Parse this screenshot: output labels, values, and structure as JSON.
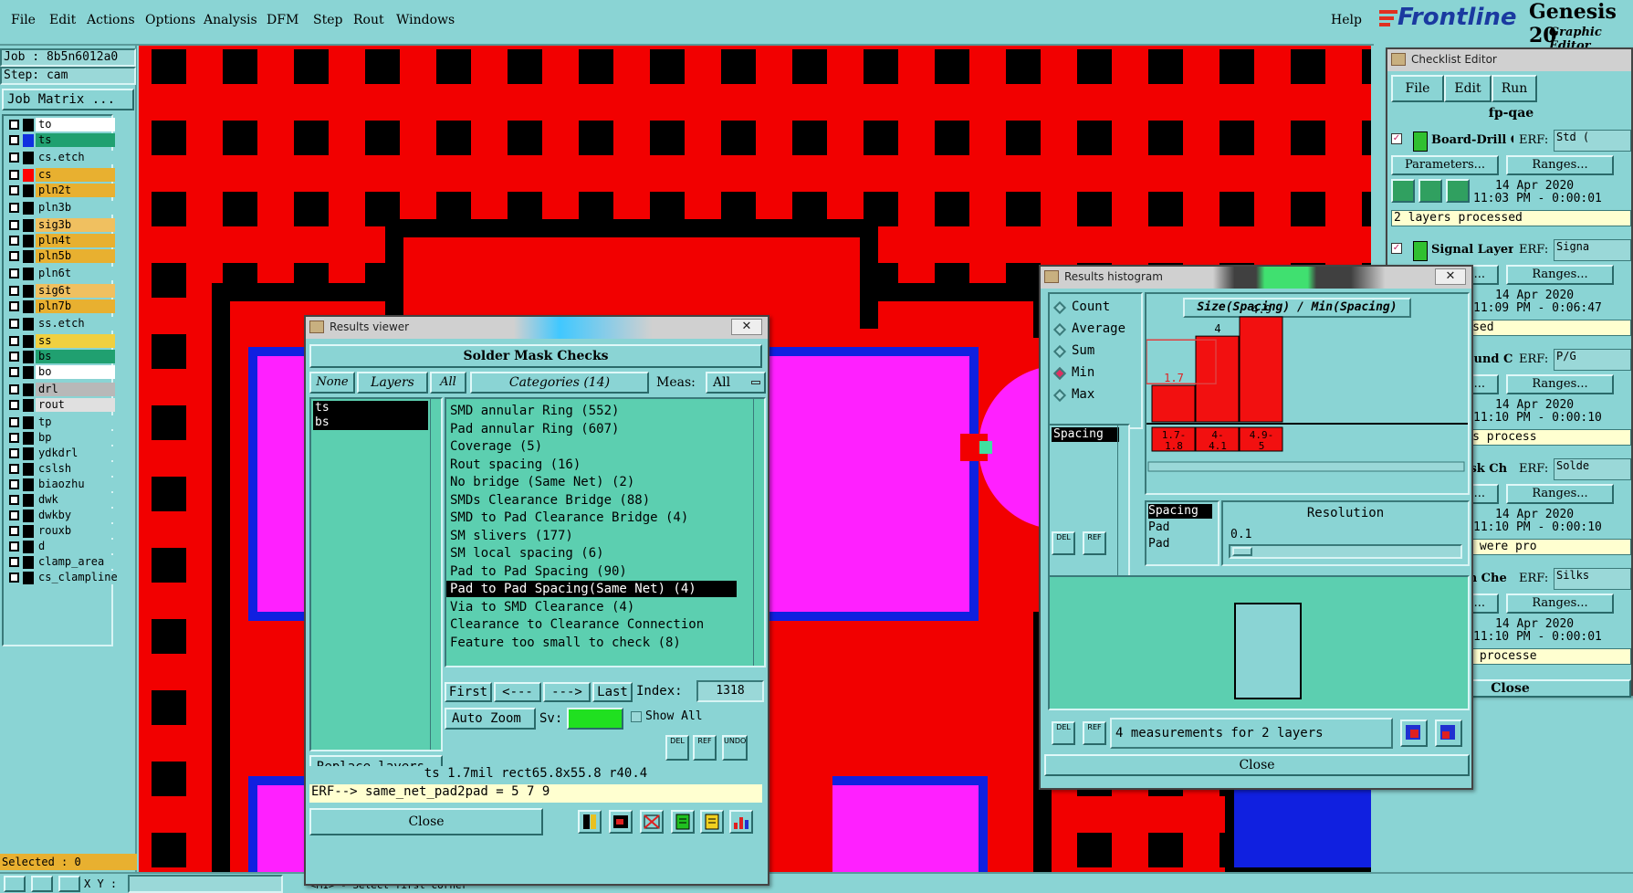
{
  "menu": {
    "items": [
      "File",
      "Edit",
      "Actions",
      "Options",
      "Analysis",
      "DFM",
      "Step",
      "Rout",
      "Windows"
    ],
    "help": "Help"
  },
  "brand": {
    "logo": "Frontline",
    "product": "Genesis 20",
    "subtitle": "Graphic Editor"
  },
  "job": {
    "job_line": "Job : 8b5n6012a0",
    "step_line": "Step: cam",
    "matrix_button": "Job Matrix ..."
  },
  "layers": [
    {
      "name": "to",
      "color": "#ffffff",
      "swatch": "#000"
    },
    {
      "name": "ts",
      "color": "#20a070",
      "swatch": "#1030e0"
    },
    {
      "name": "cs.etch",
      "color": "#8ad4d4",
      "swatch": "#000"
    },
    {
      "name": "cs",
      "color": "#e8b030",
      "swatch": "#ff0000"
    },
    {
      "name": "pln2t",
      "color": "#e8b030",
      "swatch": "#000"
    },
    {
      "name": "pln3b",
      "color": "#8ad4d4",
      "swatch": "#000"
    },
    {
      "name": "sig3b",
      "color": "#f0c060",
      "swatch": "#000"
    },
    {
      "name": "pln4t",
      "color": "#e8b030",
      "swatch": "#000"
    },
    {
      "name": "pln5b",
      "color": "#e8b030",
      "swatch": "#000"
    },
    {
      "name": "pln6t",
      "color": "#8ad4d4",
      "swatch": "#000"
    },
    {
      "name": "sig6t",
      "color": "#f0c060",
      "swatch": "#000"
    },
    {
      "name": "pln7b",
      "color": "#e8b030",
      "swatch": "#000"
    },
    {
      "name": "ss.etch",
      "color": "#8ad4d4",
      "swatch": "#000"
    },
    {
      "name": "ss",
      "color": "#f0d040",
      "swatch": "#000"
    },
    {
      "name": "bs",
      "color": "#20a070",
      "swatch": "#000"
    },
    {
      "name": "bo",
      "color": "#ffffff",
      "swatch": "#000"
    },
    {
      "name": "drl",
      "color": "#b8b8b8",
      "swatch": "#000"
    },
    {
      "name": "rout",
      "color": "#e0e0e0",
      "swatch": "#000"
    },
    {
      "name": "tp",
      "color": "#8ad4d4",
      "swatch": "#000"
    },
    {
      "name": "bp",
      "color": "#8ad4d4",
      "swatch": "#000"
    },
    {
      "name": "ydkdrl",
      "color": "#8ad4d4",
      "swatch": "#000"
    },
    {
      "name": "cslsh",
      "color": "#8ad4d4",
      "swatch": "#000"
    },
    {
      "name": "biaozhu",
      "color": "#8ad4d4",
      "swatch": "#000"
    },
    {
      "name": "dwk",
      "color": "#8ad4d4",
      "swatch": "#000"
    },
    {
      "name": "dwkby",
      "color": "#8ad4d4",
      "swatch": "#000"
    },
    {
      "name": "rouxb",
      "color": "#8ad4d4",
      "swatch": "#000"
    },
    {
      "name": "d",
      "color": "#8ad4d4",
      "swatch": "#000"
    },
    {
      "name": "clamp_area",
      "color": "#8ad4d4",
      "swatch": "#000"
    },
    {
      "name": "cs_clampline",
      "color": "#8ad4d4",
      "swatch": "#000"
    }
  ],
  "status": {
    "selected": "Selected : 0",
    "xy": "X Y :",
    "prompt": "<M1> - Select first corner"
  },
  "results_viewer": {
    "title": "Results viewer",
    "header": "Solder Mask Checks",
    "none_btn": "None",
    "layers_btn": "Layers",
    "all_btn": "All",
    "categories_btn": "Categories (14)",
    "meas_label": "Meas:",
    "meas_value": "All",
    "layer_list": [
      "ts",
      "bs"
    ],
    "categories": [
      "SMD annular Ring (552)",
      "Pad annular Ring (607)",
      "Coverage (5)",
      "Rout spacing (16)",
      "No bridge (Same Net) (2)",
      "SMDs Clearance Bridge (88)",
      "SMD to Pad Clearance Bridge (4)",
      "SM slivers (177)",
      "SM local spacing (6)",
      "Pad to Pad Spacing (90)",
      "Pad to Pad Spacing(Same Net) (4)",
      "Via to SMD Clearance (4)",
      "Clearance to Clearance Connection",
      "Feature too small to check (8)"
    ],
    "selected_index": 10,
    "nav": {
      "first": "First",
      "prev": "<---",
      "next": "--->",
      "last": "Last",
      "index_label": "Index:",
      "index_value": "1318"
    },
    "auto_zoom": "Auto Zoom",
    "sv_label": "Sv:",
    "show_all": "Show All",
    "replace_layers": "Replace layers",
    "info_line": "ts 1.7mil   rect65.8x55.8   r40.4",
    "erf_line": "ERF--> same_net_pad2pad = 5 7 9",
    "close": "Close",
    "del": "DEL",
    "ref": "REF",
    "undo": "UNDO"
  },
  "histogram": {
    "title": "Results histogram",
    "options": [
      {
        "label": "Count",
        "selected": false
      },
      {
        "label": "Average",
        "selected": false
      },
      {
        "label": "Sum",
        "selected": false
      },
      {
        "label": "Min",
        "selected": true
      },
      {
        "label": "Max",
        "selected": false
      }
    ],
    "selected_item": "Spacing",
    "chart_title": "Size(Spacing) / Min(Spacing)",
    "bars": [
      {
        "value": 1.7,
        "range": [
          "1.7-",
          "1.8"
        ]
      },
      {
        "value": 4,
        "range": [
          "4-",
          "4.1"
        ]
      },
      {
        "value": 4.9,
        "range": [
          "4.9-",
          "5"
        ]
      }
    ],
    "bar_labels": [
      "1.7",
      "4",
      "4.9"
    ],
    "types": [
      "Spacing",
      "Pad",
      "Pad"
    ],
    "resolution_label": "Resolution",
    "resolution_value": "0.1",
    "measurements": "4 measurements for 2 layers",
    "close": "Close",
    "del": "DEL",
    "ref": "REF"
  },
  "checklist": {
    "title": "Checklist Editor",
    "menu": [
      "File",
      "Edit",
      "Run"
    ],
    "name": "fp-qae",
    "items": [
      {
        "name": "Board-Drill Che",
        "erf": "Std (",
        "date": "14 Apr 2020",
        "time": "11:03 PM - 0:00:01",
        "status": "2 layers processed"
      },
      {
        "name": "Signal Layer Ch",
        "erf": "Signa",
        "date": "14 Apr 2020",
        "time": "11:09 PM - 0:06:47",
        "status": "were processed"
      },
      {
        "name": "er/Ground C",
        "erf": "P/G",
        "date": "14 Apr 2020",
        "time": "11:10 PM - 0:00:10",
        "status": "round layers process"
      },
      {
        "name": "er Mask Ch",
        "erf": "Solde",
        "date": "14 Apr 2020",
        "time": "11:10 PM - 0:00:10",
        "status": "Mask layers were pro"
      },
      {
        "name": "Screen Che",
        "erf": "Silks",
        "date": "14 Apr 2020",
        "time": "11:10 PM - 0:00:01",
        "status": "reen layers processe"
      }
    ],
    "params": "Parameters...",
    "ranges": "Ranges...",
    "erf_label": "ERF:",
    "close": "Close"
  }
}
